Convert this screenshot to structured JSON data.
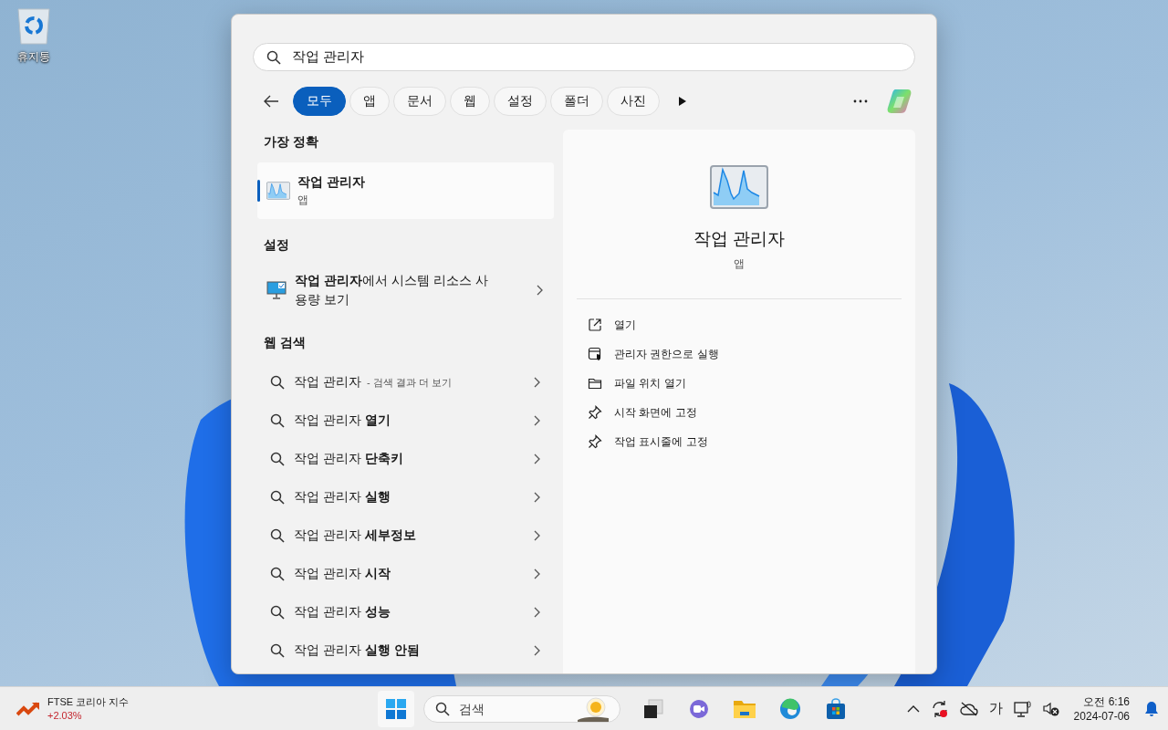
{
  "desktop": {
    "icons": [
      {
        "label": "휴지통"
      }
    ]
  },
  "search": {
    "value": "작업 관리자"
  },
  "filters": [
    {
      "label": "모두",
      "selected": true
    },
    {
      "label": "앱",
      "selected": false
    },
    {
      "label": "문서",
      "selected": false
    },
    {
      "label": "웹",
      "selected": false
    },
    {
      "label": "설정",
      "selected": false
    },
    {
      "label": "폴더",
      "selected": false
    },
    {
      "label": "사진",
      "selected": false
    }
  ],
  "best_match": {
    "heading": "가장 정확",
    "title": "작업 관리자",
    "subtitle": "앱",
    "selected": true
  },
  "settings": {
    "heading": "설정",
    "items": [
      {
        "text": "**작업 관리자**에서 시스템 리소스 사용량 보기"
      }
    ]
  },
  "web_search": {
    "heading": "웹 검색",
    "items": [
      {
        "kind": "more",
        "text": "작업 관리자",
        "hint": "- 검색 결과 더 보기"
      },
      {
        "kind": "suggestion",
        "text": "작업 관리자 **열기**"
      },
      {
        "kind": "suggestion",
        "text": "작업 관리자 **단축키**"
      },
      {
        "kind": "suggestion",
        "text": "작업 관리자 **실행**"
      },
      {
        "kind": "suggestion",
        "text": "작업 관리자 **세부정보**"
      },
      {
        "kind": "suggestion",
        "text": "작업 관리자 **시작**"
      },
      {
        "kind": "suggestion",
        "text": "작업 관리자 **성능**"
      },
      {
        "kind": "suggestion",
        "text": "작업 관리자 **실행 안됨**"
      }
    ]
  },
  "preview": {
    "title": "작업 관리자",
    "subtitle": "앱",
    "actions": [
      {
        "kind": "open",
        "label": "열기"
      },
      {
        "kind": "admin",
        "label": "관리자 권한으로 실행"
      },
      {
        "kind": "folder",
        "label": "파일 위치 열기"
      },
      {
        "kind": "pin",
        "label": "시작 화면에 고정"
      },
      {
        "kind": "pin",
        "label": "작업 표시줄에 고정"
      }
    ]
  },
  "taskbar": {
    "widget": {
      "title": "FTSE 코리아 지수",
      "change": "+2.03%"
    },
    "search": {
      "placeholder": "검색"
    },
    "apps": [
      {
        "kind": "taskview"
      },
      {
        "kind": "chat"
      },
      {
        "kind": "explorer"
      },
      {
        "kind": "edge"
      },
      {
        "kind": "store"
      }
    ],
    "tray": {
      "ime": "가",
      "time": "오전 6:16",
      "date": "2024-07-06"
    }
  }
}
